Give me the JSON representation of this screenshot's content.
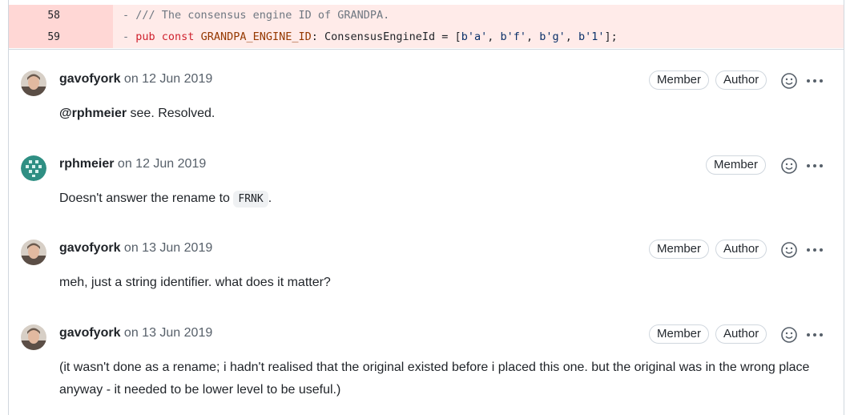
{
  "diff": {
    "lines": [
      {
        "num": "58",
        "sign": "-",
        "text": "/// The consensus engine ID of GRANDPA."
      },
      {
        "num": "59",
        "sign": "-",
        "kw": "pub const",
        "const": "GRANDPA_ENGINE_ID",
        "rest": ": ConsensusEngineId = [",
        "str1": "b'a'",
        "str2": "b'f'",
        "str3": "b'g'",
        "str4": "b'1'",
        "end": "];"
      }
    ]
  },
  "comments": [
    {
      "author": "gavofyork",
      "date": "on 12 Jun 2019",
      "badges": [
        "Member",
        "Author"
      ],
      "mention": "@rphmeier",
      "text": " see. Resolved."
    },
    {
      "author": "rphmeier",
      "date": "on 12 Jun 2019",
      "badges": [
        "Member"
      ],
      "text_before": "Doesn't answer the rename to ",
      "code": "FRNK",
      "text_after": "."
    },
    {
      "author": "gavofyork",
      "date": "on 13 Jun 2019",
      "badges": [
        "Member",
        "Author"
      ],
      "text": "meh, just a string identifier. what does it matter?"
    },
    {
      "author": "gavofyork",
      "date": "on 13 Jun 2019",
      "badges": [
        "Member",
        "Author"
      ],
      "text": "(it wasn't done as a rename; i hadn't realised that the original existed before i placed this one. but the original was in the wrong place anyway - it needed to be lower level to be useful.)"
    }
  ],
  "icons": {
    "reaction": "smiley-icon",
    "more": "kebab-horizontal-icon"
  },
  "colors": {
    "deleted_line_bg": "#ffebe9",
    "deleted_num_bg": "#ffd7d5",
    "border": "#d0d7de"
  }
}
